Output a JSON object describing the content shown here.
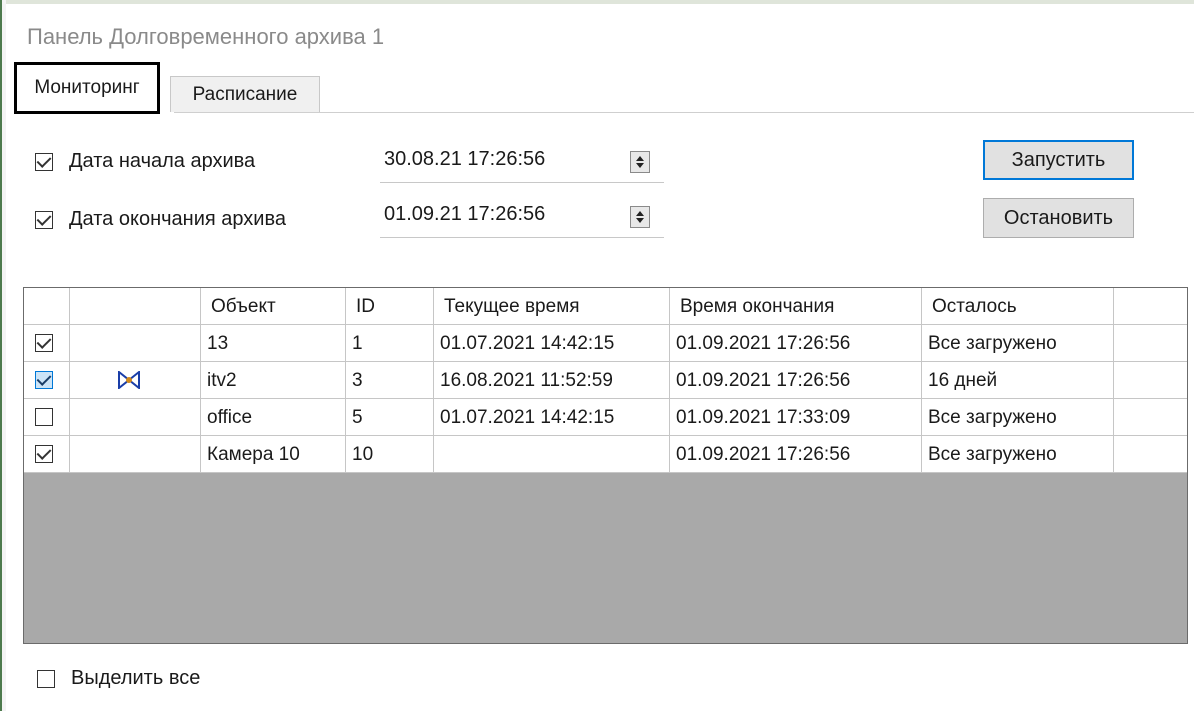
{
  "panel": {
    "title": "Панель Долговременного архива 1"
  },
  "tabs": [
    {
      "label": "Мониторинг",
      "active": true
    },
    {
      "label": "Расписание",
      "active": false
    }
  ],
  "archive": {
    "start": {
      "label": "Дата начала архива",
      "checked": true,
      "value": "30.08.21 17:26:56"
    },
    "end": {
      "label": "Дата окончания архива",
      "checked": true,
      "value": "01.09.21 17:26:56"
    }
  },
  "buttons": {
    "start": "Запустить",
    "stop": "Остановить"
  },
  "table": {
    "columns": [
      "",
      "",
      "Объект",
      "ID",
      "Текущее время",
      "Время окончания",
      "Осталось",
      ""
    ],
    "rows": [
      {
        "checked": true,
        "highlight": false,
        "icon": "",
        "object": "13",
        "id": "1",
        "current": "01.07.2021 14:42:15",
        "end": "01.09.2021 17:26:56",
        "remaining": "Все загружено"
      },
      {
        "checked": true,
        "highlight": true,
        "icon": "bowtie-icon",
        "object": "itv2",
        "id": "3",
        "current": "16.08.2021 11:52:59",
        "end": "01.09.2021 17:26:56",
        "remaining": "16 дней"
      },
      {
        "checked": false,
        "highlight": false,
        "icon": "",
        "object": "office",
        "id": "5",
        "current": "01.07.2021 14:42:15",
        "end": "01.09.2021 17:33:09",
        "remaining": "Все загружено"
      },
      {
        "checked": true,
        "highlight": false,
        "icon": "",
        "object": "Камера 10",
        "id": "10",
        "current": "",
        "end": "01.09.2021 17:26:56",
        "remaining": "Все загружено"
      }
    ]
  },
  "select_all": {
    "label": "Выделить все",
    "checked": false
  },
  "colors": {
    "accent": "#0078d7",
    "grid_empty": "#a9a9a9",
    "icon": "#1a3ea8"
  }
}
